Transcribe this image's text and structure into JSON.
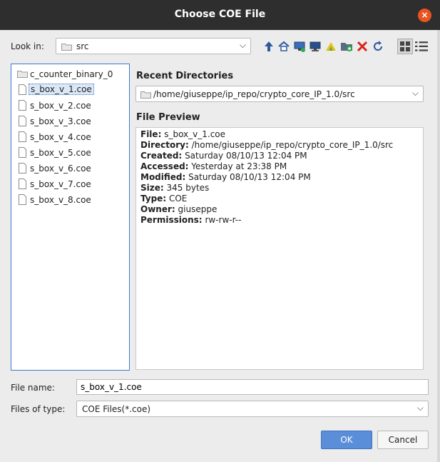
{
  "window": {
    "title": "Choose COE File",
    "close_glyph": "×"
  },
  "look_in": {
    "label": "Look in:",
    "value": "src",
    "arrow": "⌵"
  },
  "toolbar": {
    "icons": [
      "up-folder-icon",
      "home-icon",
      "desktop-icon",
      "computer-icon",
      "vivado-icon",
      "new-folder-icon",
      "delete-icon",
      "refresh-icon",
      "list-view-icon",
      "details-view-icon"
    ]
  },
  "files": [
    {
      "name": "c_counter_binary_0",
      "kind": "folder"
    },
    {
      "name": "s_box_v_1.coe",
      "kind": "file",
      "selected": true
    },
    {
      "name": "s_box_v_2.coe",
      "kind": "file"
    },
    {
      "name": "s_box_v_3.coe",
      "kind": "file"
    },
    {
      "name": "s_box_v_4.coe",
      "kind": "file"
    },
    {
      "name": "s_box_v_5.coe",
      "kind": "file"
    },
    {
      "name": "s_box_v_6.coe",
      "kind": "file"
    },
    {
      "name": "s_box_v_7.coe",
      "kind": "file"
    },
    {
      "name": "s_box_v_8.coe",
      "kind": "file"
    }
  ],
  "recent": {
    "title": "Recent Directories",
    "value": "/home/giuseppe/ip_repo/crypto_core_IP_1.0/src",
    "arrow": "⌵"
  },
  "preview": {
    "title": "File Preview",
    "rows": [
      {
        "key": "File:",
        "value": "s_box_v_1.coe"
      },
      {
        "key": "Directory:",
        "value": "/home/giuseppe/ip_repo/crypto_core_IP_1.0/src"
      },
      {
        "key": "Created:",
        "value": "Saturday 08/10/13 12:04 PM"
      },
      {
        "key": "Accessed:",
        "value": "Yesterday at 23:38 PM"
      },
      {
        "key": "Modified:",
        "value": "Saturday 08/10/13 12:04 PM"
      },
      {
        "key": "Size:",
        "value": "345 bytes"
      },
      {
        "key": "Type:",
        "value": "COE"
      },
      {
        "key": "Owner:",
        "value": "giuseppe"
      },
      {
        "key": "Permissions:",
        "value": "rw-rw-r--"
      }
    ]
  },
  "file_name": {
    "label": "File name:",
    "value": "s_box_v_1.coe"
  },
  "file_type": {
    "label": "Files of type:",
    "value": "COE Files(*.coe)",
    "arrow": "⌵"
  },
  "buttons": {
    "ok": "OK",
    "cancel": "Cancel"
  },
  "colors": {
    "accent": "#5b8ed8",
    "close": "#e95420",
    "selection_border": "#3c7ac9"
  }
}
